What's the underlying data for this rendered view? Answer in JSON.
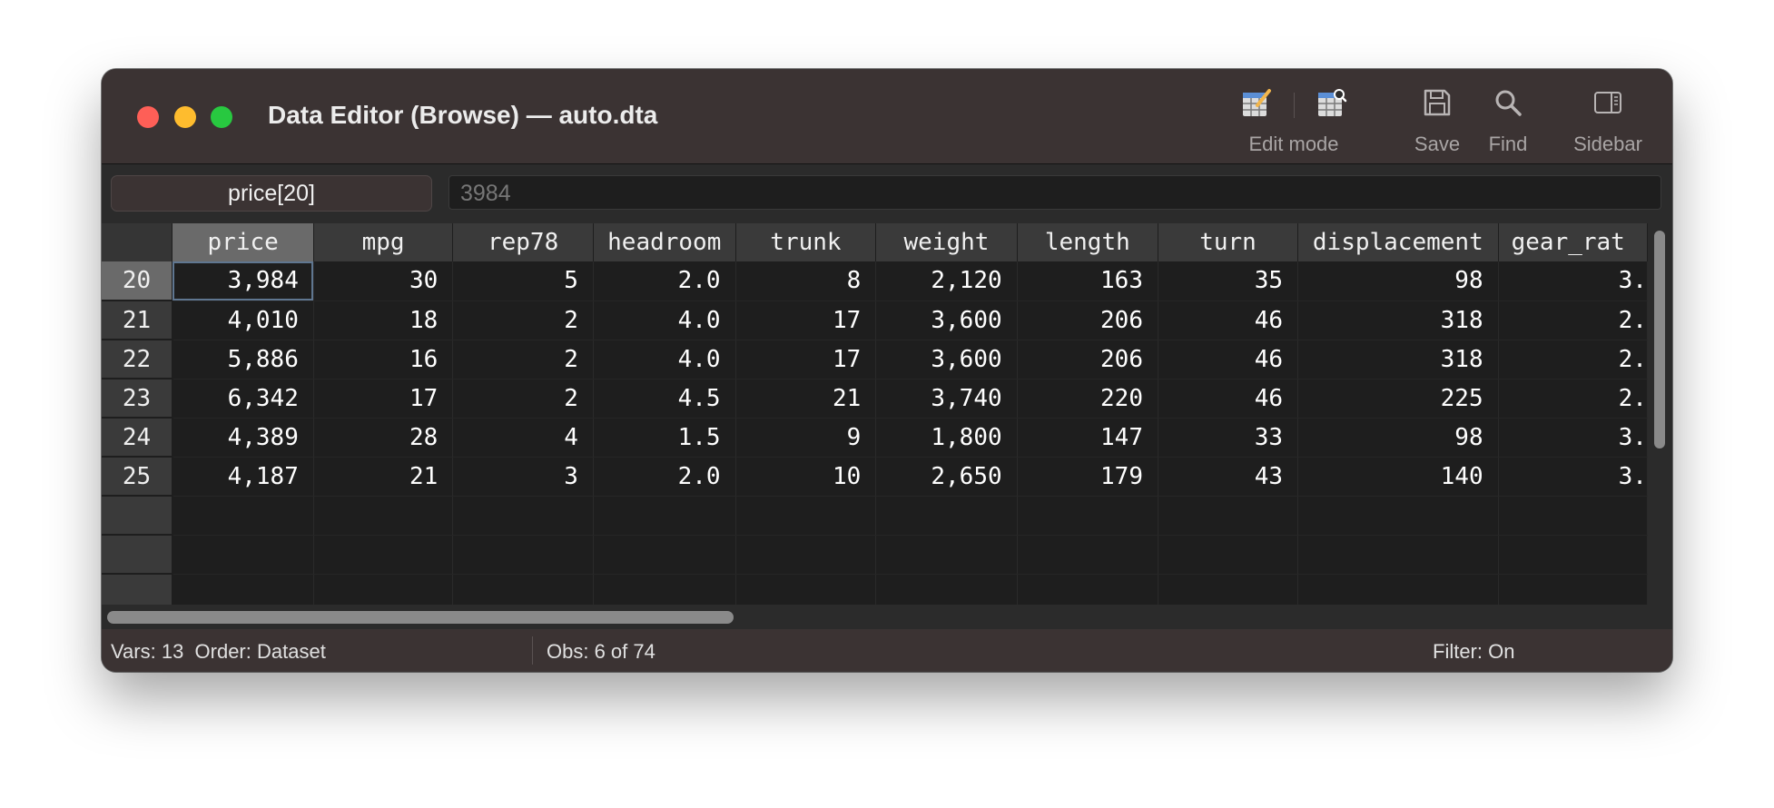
{
  "window": {
    "title": "Data Editor (Browse) — auto.dta"
  },
  "toolbar": {
    "edit_mode_label": "Edit mode",
    "save_label": "Save",
    "find_label": "Find",
    "sidebar_label": "Sidebar",
    "icons": [
      "edit-mode-pencil-icon",
      "browse-mode-icon",
      "save-icon",
      "find-icon",
      "sidebar-icon"
    ]
  },
  "varbar": {
    "cell_ref": "price[20]",
    "cell_value": "3984"
  },
  "grid": {
    "columns": [
      "price",
      "mpg",
      "rep78",
      "headroom",
      "trunk",
      "weight",
      "length",
      "turn",
      "displacement",
      "gear_rat"
    ],
    "selected_column": "price",
    "selected_row": "20",
    "rows": [
      {
        "obs": "20",
        "cells": [
          "3,984",
          "30",
          "5",
          "2.0",
          "8",
          "2,120",
          "163",
          "35",
          "98",
          "3."
        ]
      },
      {
        "obs": "21",
        "cells": [
          "4,010",
          "18",
          "2",
          "4.0",
          "17",
          "3,600",
          "206",
          "46",
          "318",
          "2."
        ]
      },
      {
        "obs": "22",
        "cells": [
          "5,886",
          "16",
          "2",
          "4.0",
          "17",
          "3,600",
          "206",
          "46",
          "318",
          "2."
        ]
      },
      {
        "obs": "23",
        "cells": [
          "6,342",
          "17",
          "2",
          "4.5",
          "21",
          "3,740",
          "220",
          "46",
          "225",
          "2."
        ]
      },
      {
        "obs": "24",
        "cells": [
          "4,389",
          "28",
          "4",
          "1.5",
          "9",
          "1,800",
          "147",
          "33",
          "98",
          "3."
        ]
      },
      {
        "obs": "25",
        "cells": [
          "4,187",
          "21",
          "3",
          "2.0",
          "10",
          "2,650",
          "179",
          "43",
          "140",
          "3."
        ]
      }
    ]
  },
  "status": {
    "vars": "Vars: 13  Order: Dataset",
    "obs": "Obs: 6 of 74",
    "filter": "Filter: On"
  },
  "colors": {
    "titlebar": "#3b3333",
    "grid_bg": "#1e1e1e",
    "header_bg": "#3a3a3a",
    "selected_header": "#6a6a6a",
    "active_cell_outline": "#5f7690"
  }
}
